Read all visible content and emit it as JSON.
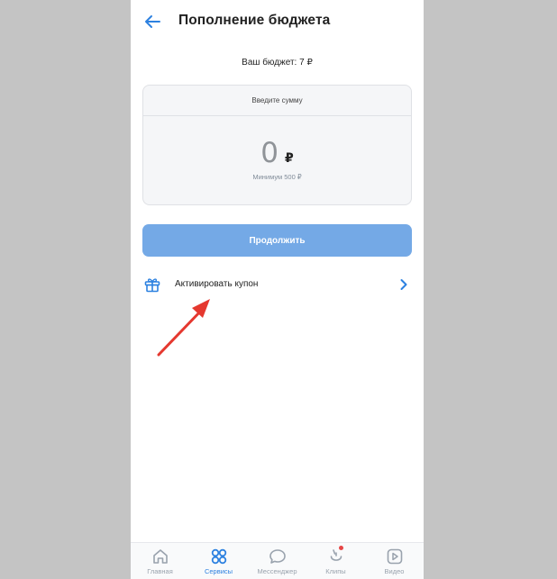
{
  "header": {
    "title": "Пополнение бюджета"
  },
  "budget": {
    "label": "Ваш бюджет: 7 ₽"
  },
  "amount_card": {
    "prompt": "Введите сумму",
    "value": "0",
    "currency": "₽",
    "minimum": "Минимум 500 ₽"
  },
  "continue_button": {
    "label": "Продолжить"
  },
  "coupon": {
    "label": "Активировать купон"
  },
  "annotation": {
    "arrow_color": "#e5382f"
  },
  "tabbar": {
    "tabs": [
      {
        "label": "Главная",
        "icon": "home-icon",
        "active": false
      },
      {
        "label": "Сервисы",
        "icon": "services-icon",
        "active": true
      },
      {
        "label": "Мессенджер",
        "icon": "chat-icon",
        "active": false
      },
      {
        "label": "Клипы",
        "icon": "clips-icon",
        "active": false
      },
      {
        "label": "Видео",
        "icon": "video-icon",
        "active": false
      }
    ]
  },
  "colors": {
    "accent": "#2d81e0",
    "button": "#74a9e6",
    "background": "#c4c4c4"
  }
}
